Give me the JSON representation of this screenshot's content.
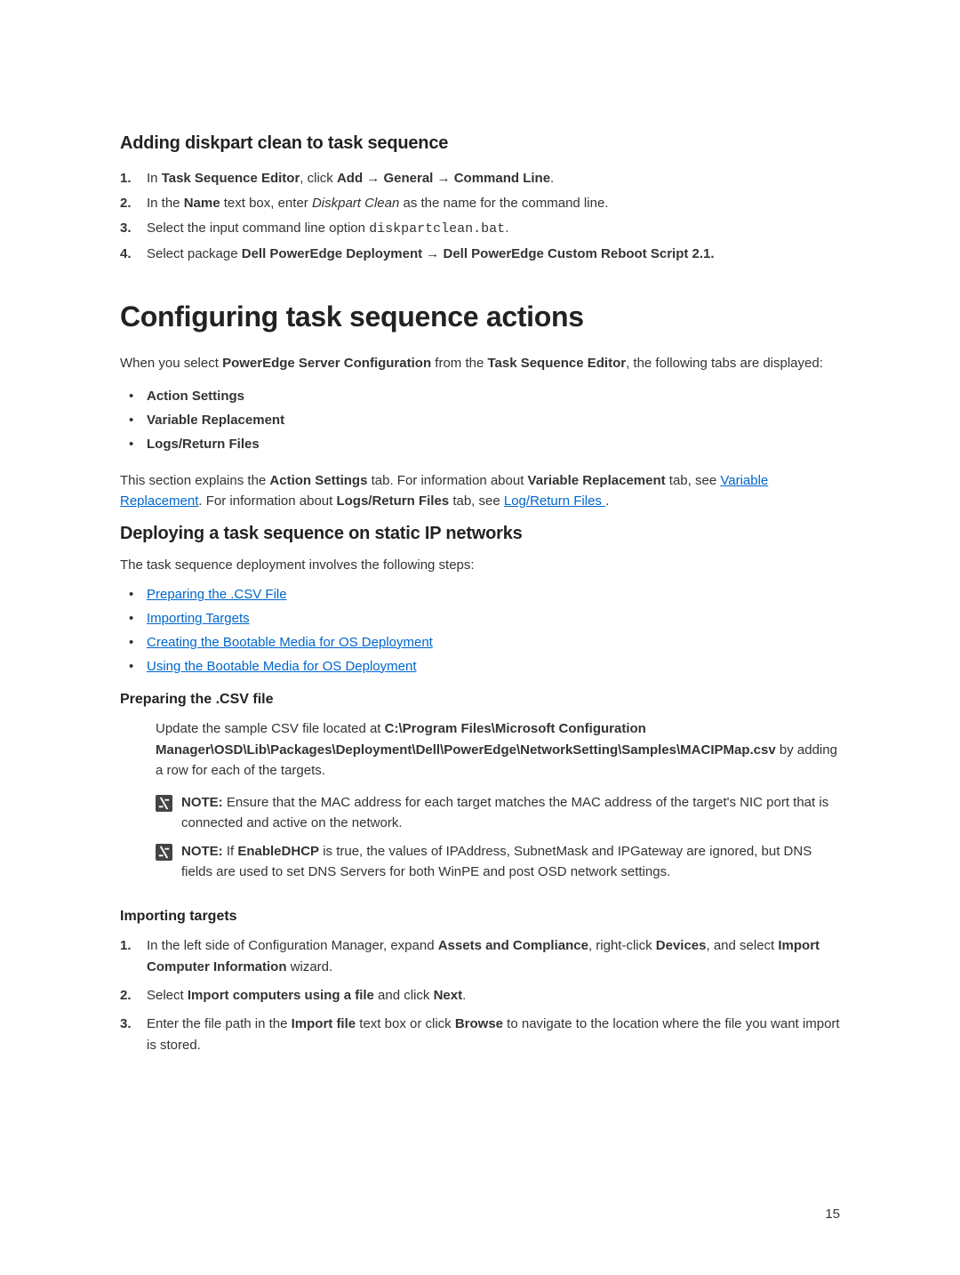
{
  "section_diskpart": {
    "title": "Adding diskpart clean to task sequence",
    "steps": [
      {
        "n": "1.",
        "pre": "In ",
        "b1": "Task Sequence Editor",
        "mid1": ", click ",
        "b2": "Add",
        "arrow1": " → ",
        "b3": "General",
        "arrow2": " → ",
        "b4": "Command Line",
        "tail": "."
      },
      {
        "n": "2.",
        "pre": "In the ",
        "b1": "Name",
        "mid1": " text box, enter ",
        "i1": "Diskpart Clean",
        "tail": " as the name for the command line."
      },
      {
        "n": "3.",
        "pre": "Select the input command line option ",
        "code1": "diskpartclean.bat",
        "tail": "."
      },
      {
        "n": "4.",
        "pre": "Select package ",
        "b1": "Dell PowerEdge Deployment",
        "arrow1": " → ",
        "b2": "Dell PowerEdge Custom Reboot Script 2.1.",
        "tail": ""
      }
    ]
  },
  "main_heading": "Configuring task sequence actions",
  "intro_para": {
    "pre": "When you select ",
    "b1": "PowerEdge Server Configuration",
    "mid1": " from the ",
    "b2": "Task Sequence Editor",
    "tail": ", the following tabs are displayed:"
  },
  "tabs_list": [
    "Action Settings",
    "Variable Replacement",
    "Logs/Return Files"
  ],
  "explain_para": {
    "pre": "This section explains the ",
    "b1": "Action Settings",
    "mid1": " tab. For information about ",
    "b2": "Variable Replacement",
    "mid2": " tab, see ",
    "link1": "Variable Replacement",
    "mid3": ". For information about ",
    "b3": "Logs/Return Files",
    "mid4": " tab, see ",
    "link2": "Log/Return Files ",
    "tail": "."
  },
  "deploy_section": {
    "title": "Deploying a task sequence on static IP networks",
    "intro": "The task sequence deployment involves the following steps:",
    "links": [
      "Preparing the .CSV File",
      "Importing Targets",
      "Creating the Bootable Media for OS Deployment",
      "Using the Bootable Media for OS Deployment"
    ]
  },
  "csv_section": {
    "title": "Preparing the .CSV file",
    "body": {
      "pre": "Update the sample CSV file located at ",
      "path": "C:\\Program Files\\Microsoft Configuration Manager\\OSD\\Lib\\Packages\\Deployment\\Dell\\PowerEdge\\NetworkSetting\\Samples\\MACIPMap.csv",
      "tail": " by adding a row for each of the targets."
    },
    "note1": {
      "label": "NOTE:",
      "text": " Ensure that the MAC address for each target matches the MAC address of the target's NIC port that is connected and active on the network."
    },
    "note2": {
      "label": "NOTE:",
      "pre": " If ",
      "b1": "EnableDHCP",
      "text": " is true, the values of IPAddress, SubnetMask and IPGateway are ignored, but DNS fields are used to set DNS Servers for both WinPE and post OSD network settings."
    }
  },
  "import_section": {
    "title": "Importing targets",
    "steps": [
      {
        "n": "1.",
        "pre": "In the left side of Configuration Manager, expand ",
        "b1": "Assets and Compliance",
        "mid1": ", right-click ",
        "b2": "Devices",
        "mid2": ", and select ",
        "b3": "Import Computer Information",
        "tail": " wizard."
      },
      {
        "n": "2.",
        "pre": "Select ",
        "b1": "Import computers using a file",
        "mid1": " and click ",
        "b2": "Next",
        "tail": "."
      },
      {
        "n": "3.",
        "pre": "Enter the file path in the ",
        "b1": "Import file",
        "mid1": " text box or click ",
        "b2": "Browse",
        "tail": " to navigate to the location where the file you want import is stored."
      }
    ]
  },
  "page_number": "15"
}
